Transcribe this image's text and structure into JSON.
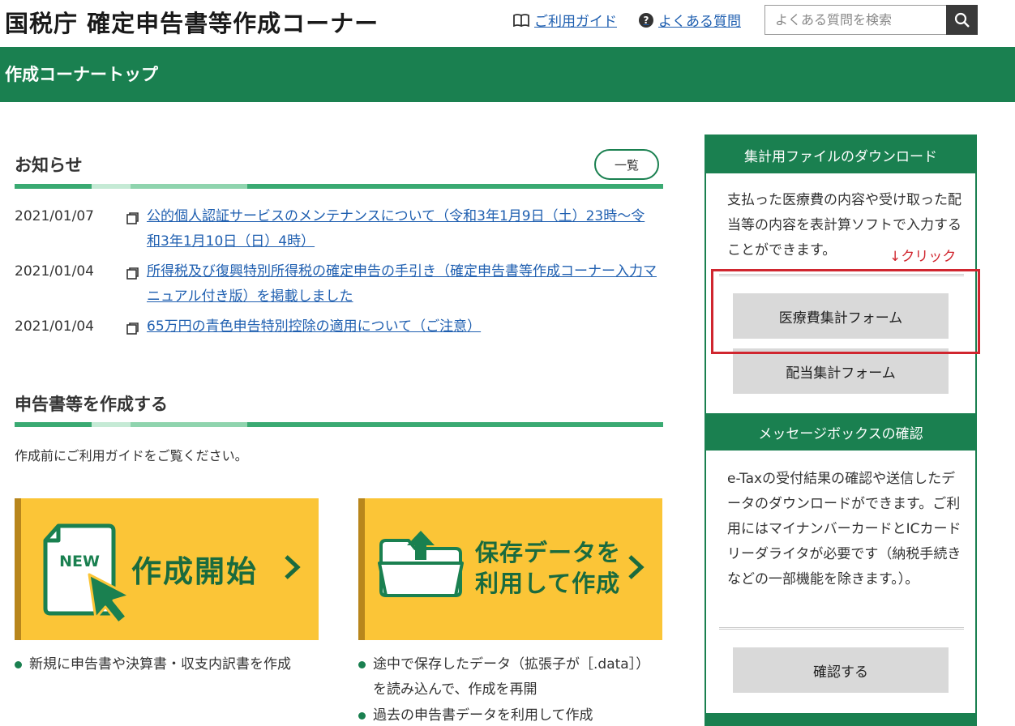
{
  "header": {
    "title": "国税庁 確定申告書等作成コーナー",
    "guide_label": "ご利用ガイド",
    "faq_label": "よくある質問",
    "search_placeholder": "よくある質問を検索"
  },
  "page": {
    "title": "作成コーナートップ"
  },
  "news": {
    "heading": "お知らせ",
    "list_button": "一覧",
    "items": [
      {
        "date": "2021/01/07",
        "text": "公的個人認証サービスのメンテナンスについて（令和3年1月9日（土）23時～令和3年1月10日（日）4時）"
      },
      {
        "date": "2021/01/04",
        "text": "所得税及び復興特別所得税の確定申告の手引き（確定申告書等作成コーナー入力マニュアル付き版）を掲載しました"
      },
      {
        "date": "2021/01/04",
        "text": "65万円の青色申告特別控除の適用について（ご注意）"
      }
    ]
  },
  "create": {
    "heading": "申告書等を作成する",
    "intro": "作成前にご利用ガイドをご覧ください。",
    "start_card": {
      "label": "作成開始",
      "badge": "NEW",
      "bullet": "新規に申告書や決算書・収支内訳書を作成"
    },
    "resume_card": {
      "label_line1": "保存データを",
      "label_line2": "利用して作成",
      "bullet1": "途中で保存したデータ（拡張子が［.data］）を読み込んで、作成を再開",
      "bullet2": "過去の申告書データを利用して作成"
    }
  },
  "sidebar": {
    "download": {
      "heading": "集計用ファイルのダウンロード",
      "text": "支払った医療費の内容や受け取った配当等の内容を表計算ソフトで入力することができます。",
      "note": "↓クリック",
      "medical_button": "医療費集計フォーム",
      "dividend_button": "配当集計フォーム"
    },
    "message": {
      "heading": "メッセージボックスの確認",
      "text": "e-Taxの受付結果の確認や送信したデータのダウンロードができます。ご利用にはマイナンバーカードとICカードリーダライタが必要です（納税手続きなどの一部機能を除きます。）。",
      "confirm_button": "確認する"
    }
  },
  "colors": {
    "brand_green": "#1a8050",
    "card_yellow": "#fbc537",
    "link_blue": "#1f5fb0",
    "highlight_red": "#d0262f"
  },
  "icons": [
    "book-icon",
    "question-icon",
    "search-icon",
    "window-icon",
    "new-document-icon",
    "cursor-arrow-icon",
    "folder-upload-icon",
    "chevron-right-icon"
  ]
}
